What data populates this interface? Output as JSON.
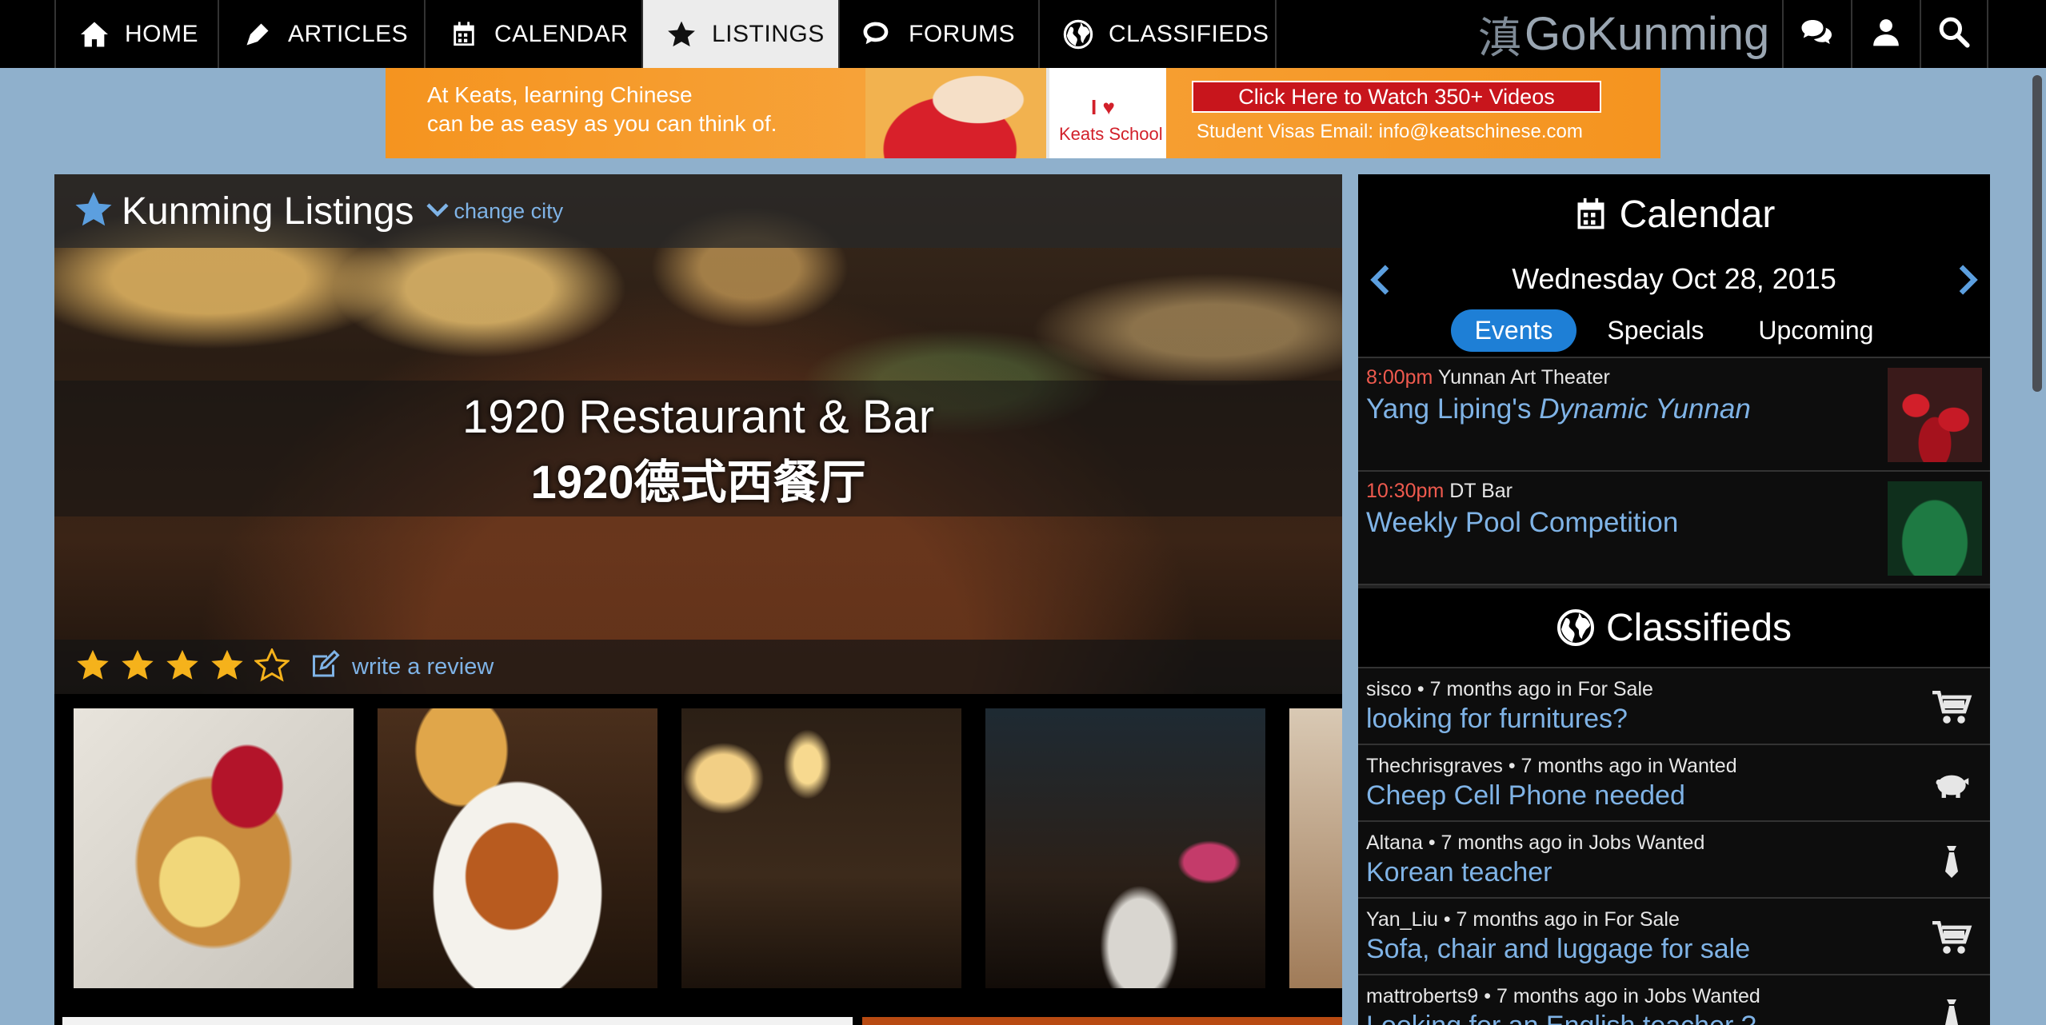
{
  "nav": {
    "items": [
      {
        "label": "HOME",
        "icon": "home-icon"
      },
      {
        "label": "ARTICLES",
        "icon": "pen-icon"
      },
      {
        "label": "CALENDAR",
        "icon": "calendar-icon"
      },
      {
        "label": "LISTINGS",
        "icon": "star-icon",
        "active": true
      },
      {
        "label": "FORUMS",
        "icon": "chat-icon"
      },
      {
        "label": "CLASSIFIEDS",
        "icon": "globe-icon"
      }
    ],
    "logo_cjk": "滇",
    "logo_text": "GoKunming",
    "right_icons": [
      "messages-icon",
      "user-icon",
      "search-icon"
    ]
  },
  "ad": {
    "line1": "At Keats, learning Chinese",
    "line2": "can be as easy as you can think of.",
    "heart": "I ♥",
    "school": "Keats School",
    "cta": "Click Here to Watch 350+ Videos",
    "info": "Student Visas    Email: info@keatschinese.com"
  },
  "listing": {
    "section_title": "Kunming Listings",
    "change_city": "change city",
    "name_en": "1920 Restaurant & Bar",
    "name_zh": "1920德式西餐厅",
    "rating": 4,
    "rating_max": 5,
    "write_review": "write a review"
  },
  "calendar": {
    "title": "Calendar",
    "date": "Wednesday Oct 28, 2015",
    "tabs": [
      "Events",
      "Specials",
      "Upcoming"
    ],
    "events": [
      {
        "time": "8:00pm",
        "venue": "Yunnan Art Theater",
        "title_pre": "Yang Liping's ",
        "title_em": "Dynamic Yunnan"
      },
      {
        "time": "10:30pm",
        "venue": "DT Bar",
        "title_pre": "Weekly Pool Competition",
        "title_em": ""
      }
    ]
  },
  "classifieds": {
    "title": "Classifieds",
    "items": [
      {
        "meta": "sisco • 7 months ago in For Sale",
        "title": "looking for furnitures?",
        "icon": "cart-icon"
      },
      {
        "meta": "Thechrisgraves • 7 months ago in Wanted",
        "title": "Cheep Cell Phone needed",
        "icon": "piggy-bank-icon"
      },
      {
        "meta": "Altana • 7 months ago in Jobs Wanted",
        "title": "Korean teacher",
        "icon": "tie-icon"
      },
      {
        "meta": "Yan_Liu • 7 months ago in For Sale",
        "title": "Sofa, chair and luggage for sale",
        "icon": "cart-icon"
      },
      {
        "meta": "mattroberts9 • 7 months ago in Jobs Wanted",
        "title": "Looking for an English teacher ?",
        "icon": "tie-icon"
      }
    ]
  },
  "colors": {
    "accent_blue": "#7fb3e6",
    "tab_active": "#1e7fd6",
    "event_time": "#ef5a4e",
    "page_bg": "#8fb0cc"
  }
}
